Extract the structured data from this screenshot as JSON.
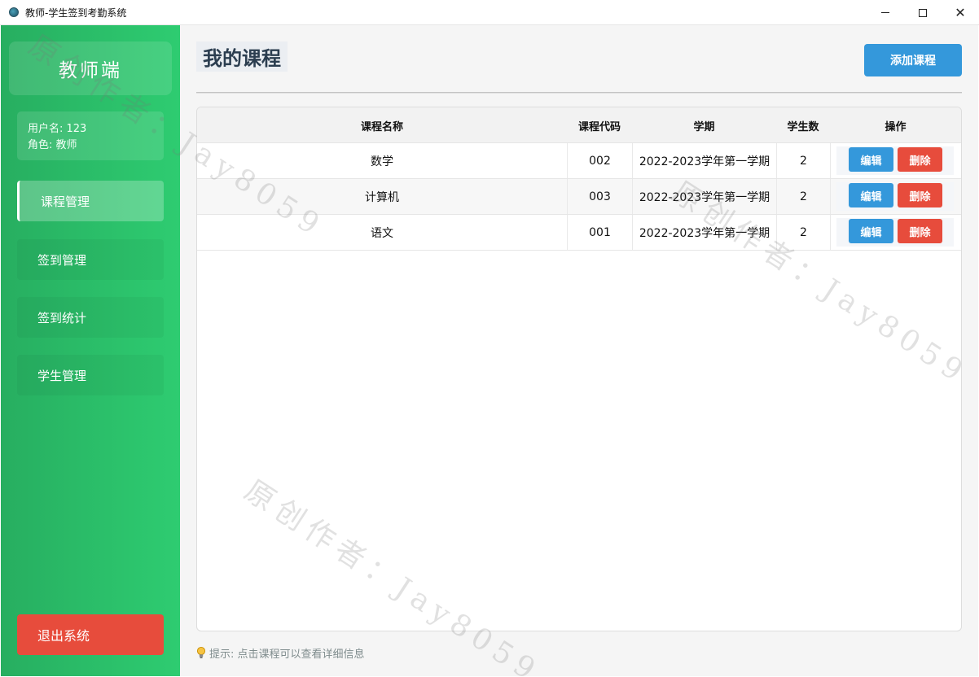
{
  "window": {
    "title": "教师-学生签到考勤系统",
    "controls": [
      "minimize-icon",
      "maximize-icon",
      "close-icon"
    ],
    "close_symbol": "✕"
  },
  "sidebar": {
    "brand": "教师端",
    "user_line": "用户名: 123",
    "role_line": "角色: 教师",
    "items": [
      {
        "label": "课程管理",
        "active": true
      },
      {
        "label": "签到管理",
        "active": false
      },
      {
        "label": "签到统计",
        "active": false
      },
      {
        "label": "学生管理",
        "active": false
      }
    ],
    "logout": "退出系统"
  },
  "main": {
    "title": "我的课程",
    "add_button": "添加课程",
    "table": {
      "headers": [
        "课程名称",
        "课程代码",
        "学期",
        "学生数",
        "操作"
      ],
      "rows": [
        {
          "name": "数学",
          "code": "002",
          "term": "2022-2023学年第一学期",
          "count": "2",
          "edit": "编辑",
          "delete": "删除"
        },
        {
          "name": "计算机",
          "code": "003",
          "term": "2022-2023学年第一学期",
          "count": "2",
          "edit": "编辑",
          "delete": "删除"
        },
        {
          "name": "语文",
          "code": "001",
          "term": "2022-2023学年第一学期",
          "count": "2",
          "edit": "编辑",
          "delete": "删除"
        }
      ]
    },
    "hint": "提示: 点击课程可以查看详细信息",
    "hint_icon": "lightbulb-icon"
  },
  "watermark": "原创作者：Jay8059",
  "colors": {
    "sidebar_green_start": "#27ae60",
    "sidebar_green_end": "#2ecc71",
    "primary_blue": "#3498db",
    "danger_red": "#e74c3c",
    "title_text": "#2c3e50"
  }
}
